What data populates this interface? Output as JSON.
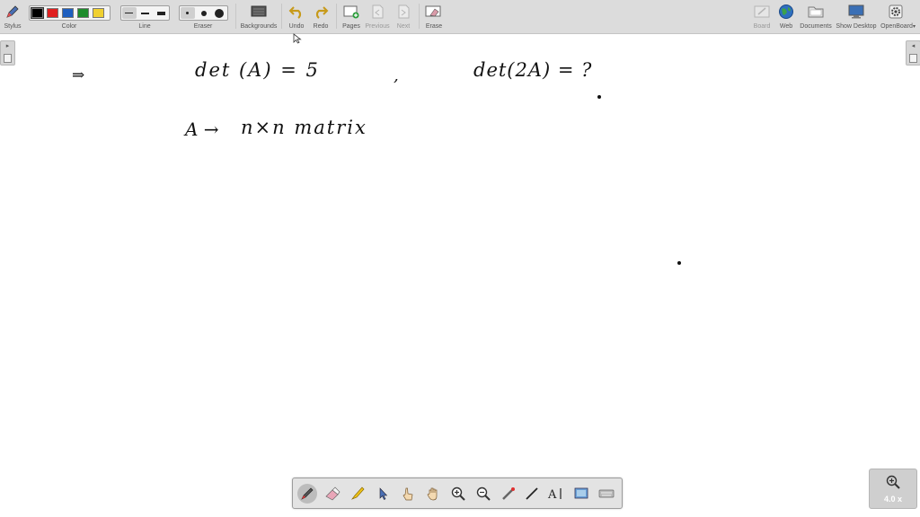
{
  "toolbar": {
    "stylus_label": "Stylus",
    "color_label": "Color",
    "line_label": "Line",
    "eraser_label": "Eraser",
    "backgrounds_label": "Backgrounds",
    "undo_label": "Undo",
    "redo_label": "Redo",
    "pages_label": "Pages",
    "previous_label": "Previous",
    "next_label": "Next",
    "erase_label": "Erase",
    "board_label": "Board",
    "web_label": "Web",
    "documents_label": "Documents",
    "show_desktop_label": "Show Desktop",
    "openboard_label": "OpenBoard",
    "colors": [
      "#000000",
      "#e02020",
      "#1f5fbf",
      "#1e8c2c",
      "#f0d030"
    ],
    "selected_color_index": 0,
    "selected_line_index": 0,
    "selected_eraser_index": 0
  },
  "board": {
    "line1": {
      "arrow": "⇒",
      "left_expr": "det (A) = 5",
      "comma": ",",
      "right_expr": "det(2A) = ?"
    },
    "line2": {
      "left": "A →",
      "right": "n×n matrix"
    }
  },
  "palette": {
    "tools": [
      "pen-tool",
      "eraser-tool",
      "highlighter-tool",
      "select-tool",
      "interact-tool",
      "hand-tool",
      "zoom-in-tool",
      "zoom-out-tool",
      "laser-pointer-tool",
      "line-tool",
      "text-tool",
      "capture-tool",
      "keyboard-tool"
    ],
    "active_tool": "pen-tool"
  },
  "zoom": {
    "level": "4.0 x"
  },
  "colors": {
    "toolbar_bg": "#dcdcdc",
    "board_bg": "#ffffff",
    "ink": "#111111"
  }
}
